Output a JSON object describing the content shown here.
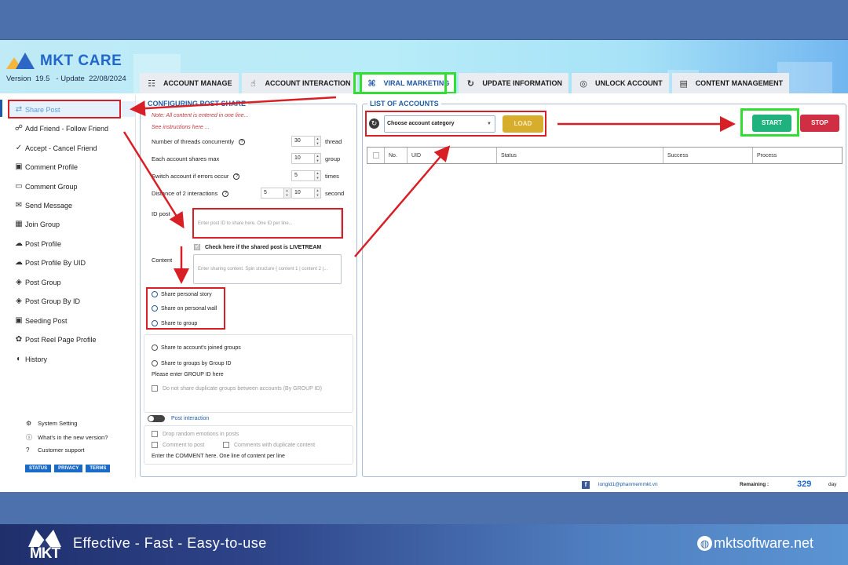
{
  "app": {
    "name": "MKT CARE",
    "version_label": "Version",
    "version": "19.5",
    "update_label": "- Update",
    "update_date": "22/08/2024"
  },
  "tabs": [
    {
      "label": "ACCOUNT MANAGE",
      "icon": "list-search-icon",
      "glyph": "☷",
      "active": false
    },
    {
      "label": "ACCOUNT INTERACTION",
      "icon": "hand-pointer-icon",
      "glyph": "☝",
      "active": false
    },
    {
      "label": "VIRAL MARKETING",
      "icon": "grid-share-icon",
      "glyph": "⌘",
      "active": true
    },
    {
      "label": "UPDATE INFORMATION",
      "icon": "refresh-user-icon",
      "glyph": "↻",
      "active": false
    },
    {
      "label": "UNLOCK ACCOUNT",
      "icon": "fingerprint-icon",
      "glyph": "◎",
      "active": false
    },
    {
      "label": "CONTENT MANAGEMENT",
      "icon": "document-icon",
      "glyph": "▤",
      "active": false
    }
  ],
  "sidebar": {
    "items": [
      {
        "label": "Share Post",
        "icon": "share-arrows-icon",
        "glyph": "⇄",
        "active": true
      },
      {
        "label": "Add Friend - Follow Friend",
        "icon": "add-friend-icon",
        "glyph": "☍"
      },
      {
        "label": "Accept - Cancel Friend",
        "icon": "check-circle-icon",
        "glyph": "✓"
      },
      {
        "label": "Comment Profile",
        "icon": "profile-card-icon",
        "glyph": "▣"
      },
      {
        "label": "Comment Group",
        "icon": "comment-icon",
        "glyph": "▭"
      },
      {
        "label": "Send Message",
        "icon": "message-icon",
        "glyph": "✉"
      },
      {
        "label": "Join Group",
        "icon": "group-icon",
        "glyph": "▦"
      },
      {
        "label": "Post Profile",
        "icon": "cloud-upload-icon",
        "glyph": "☁"
      },
      {
        "label": "Post Profile By UID",
        "icon": "cloud-upload-icon",
        "glyph": "☁"
      },
      {
        "label": "Post Group",
        "icon": "post-group-icon",
        "glyph": "◈"
      },
      {
        "label": "Post Group By ID",
        "icon": "post-group-icon",
        "glyph": "◈"
      },
      {
        "label": "Seeding Post",
        "icon": "seeding-icon",
        "glyph": "▣"
      },
      {
        "label": "Post Reel Page Profile",
        "icon": "reel-icon",
        "glyph": "✿"
      },
      {
        "label": "History",
        "icon": "history-icon",
        "glyph": "◐"
      }
    ],
    "footer": [
      {
        "label": "System Setting",
        "icon": "gear-icon",
        "glyph": "⚙"
      },
      {
        "label": "What's in the new version?",
        "icon": "info-icon",
        "glyph": "ⓘ"
      },
      {
        "label": "Customer support",
        "icon": "help-icon",
        "glyph": "?"
      }
    ],
    "badges": [
      "STATUS",
      "PRIVACY",
      "TERMS"
    ]
  },
  "config": {
    "title": "CONFIGURING POST SHARE",
    "note1": "Note: All content is entered in one line...",
    "note2": "See instructions here ...",
    "threads": {
      "label": "Number of threads concurrently",
      "value": "30",
      "unit": "thread"
    },
    "shares_max": {
      "label": "Each account shares max",
      "value": "10",
      "unit": "group"
    },
    "switch_errors": {
      "label": "Switch account if errors occur",
      "value": "5",
      "unit": "times"
    },
    "distance": {
      "label": "Distance of 2 interactions",
      "min": "5",
      "max": "10",
      "unit": "second"
    },
    "id_post": {
      "label": "ID post",
      "placeholder": "Enter post ID to share here. One ID per line..."
    },
    "livestream_check": {
      "label": "Check here if the shared post is LIVETREAM",
      "checked": true
    },
    "content": {
      "label": "Content",
      "placeholder": "Enter sharing content. Spin structure { content 1 | content 2 |..."
    },
    "share_options": [
      "Share personal story",
      "Share on personal wall",
      "Share to group"
    ],
    "group_options": [
      "Share to account's joined groups",
      "Share to groups by Group ID"
    ],
    "group_id_hint": "Please enter GROUP ID here",
    "no_duplicate_groups": "Do not share duplicate groups between accounts (By GROUP ID)",
    "post_interaction": {
      "label": "Post interaction",
      "enabled": false
    },
    "drop_emotions": "Drop random emotions in posts",
    "comment_to_post": "Comment to post",
    "duplicate_comments": "Comments with duplicate content",
    "comment_hint": "Enter the COMMENT here.  One line of content per line"
  },
  "accounts": {
    "title": "LIST OF ACCOUNTS",
    "category_select": "Choose account category",
    "load_label": "LOAD",
    "start_label": "START",
    "stop_label": "STOP",
    "columns": [
      "",
      "No.",
      "UID",
      "Status",
      "Success",
      "Process"
    ]
  },
  "statusbar": {
    "email": "longld1@phanmemmkt.vn",
    "remaining_label": "Remaining :",
    "remaining_value": "329",
    "remaining_unit": "day"
  },
  "banner": {
    "logo_text": "MKT",
    "tagline": "Effective - Fast - Easy-to-use",
    "site": "mktsoftware.net"
  },
  "colors": {
    "accent": "#1f5fa8",
    "load": "#d6ad2c",
    "start": "#1fb27f",
    "stop": "#d02f43",
    "annotation_red": "#d81f26",
    "annotation_green": "#33dd33"
  }
}
